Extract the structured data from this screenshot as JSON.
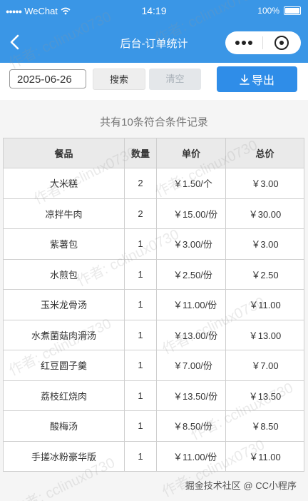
{
  "status_bar": {
    "carrier": "WeChat",
    "time": "14:19",
    "battery": "100%"
  },
  "nav": {
    "title": "后台-订单统计"
  },
  "toolbar": {
    "date": "2025-06-26",
    "search_label": "搜索",
    "clear_label": "清空",
    "export_label": "导出"
  },
  "summary": "共有10条符合条件记录",
  "table": {
    "headers": [
      "餐品",
      "数量",
      "单价",
      "总价"
    ],
    "rows": [
      {
        "item": "大米糕",
        "qty": "2",
        "unit": "￥1.50/个",
        "total": "￥3.00"
      },
      {
        "item": "凉拌牛肉",
        "qty": "2",
        "unit": "￥15.00/份",
        "total": "￥30.00"
      },
      {
        "item": "紫薯包",
        "qty": "1",
        "unit": "￥3.00/份",
        "total": "￥3.00"
      },
      {
        "item": "水煎包",
        "qty": "1",
        "unit": "￥2.50/份",
        "total": "￥2.50"
      },
      {
        "item": "玉米龙骨汤",
        "qty": "1",
        "unit": "￥11.00/份",
        "total": "￥11.00"
      },
      {
        "item": "水煮菌菇肉滑汤",
        "qty": "1",
        "unit": "￥13.00/份",
        "total": "￥13.00"
      },
      {
        "item": "红豆圆子羹",
        "qty": "1",
        "unit": "￥7.00/份",
        "total": "￥7.00"
      },
      {
        "item": "荔枝红烧肉",
        "qty": "1",
        "unit": "￥13.50/份",
        "total": "￥13.50"
      },
      {
        "item": "酸梅汤",
        "qty": "1",
        "unit": "￥8.50/份",
        "total": "￥8.50"
      },
      {
        "item": "手搓冰粉豪华版",
        "qty": "1",
        "unit": "￥11.00/份",
        "total": "￥11.00"
      }
    ]
  },
  "watermark": "作者: cclinux0730",
  "footer_credit": "掘金技术社区 @ CC小程序",
  "colors": {
    "primary": "#3a96e6",
    "export_button": "#2f8de8"
  },
  "icons": {
    "back": "chevron-left-icon",
    "more": "more-dots-icon",
    "close": "close-circle-icon",
    "download": "download-icon",
    "wifi": "wifi-icon",
    "signal": "signal-dots-icon",
    "battery": "battery-icon"
  }
}
